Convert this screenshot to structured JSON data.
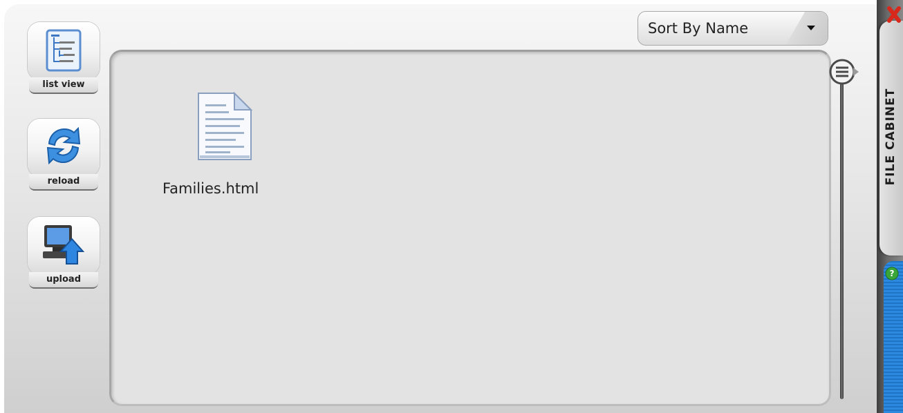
{
  "toolbar": {
    "list_view_label": "list view",
    "reload_label": "reload",
    "upload_label": "upload"
  },
  "sort": {
    "label": "Sort By Name"
  },
  "files": [
    {
      "name": "Families.html",
      "icon": "html-document-icon"
    }
  ],
  "tab": {
    "title": "FILE CABINET"
  },
  "colors": {
    "accent_blue": "#2b8ae0",
    "close_red": "#d8281c",
    "help_green": "#3aa63a"
  }
}
